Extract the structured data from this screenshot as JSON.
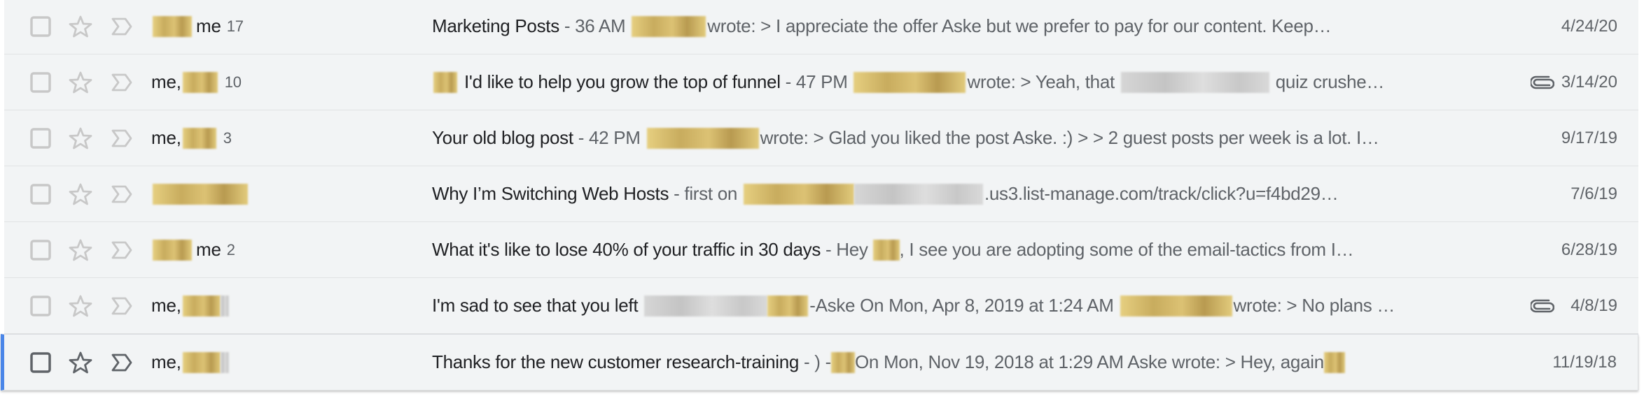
{
  "colors": {
    "row_bg": "#f2f4f5",
    "active_indicator": "#4a86e8",
    "primary_text": "#202124",
    "secondary_text": "#5f6368",
    "icon_inactive": "#c8c8c8",
    "icon_active": "#5f6368"
  },
  "icons": {
    "checkbox": "checkbox-icon",
    "star": "star-icon",
    "importance": "importance-marker-icon",
    "attachment": "paperclip-icon"
  },
  "threads": [
    {
      "sender_prefix": "",
      "sender_redacted": true,
      "sender_suffix": "me",
      "count": "17",
      "subject": "Marketing Posts",
      "snippet_parts": [
        " - 36 AM ",
        "[redacted]",
        "wrote: > I appreciate the offer Aske but we prefer to pay for our content. Keep…"
      ],
      "has_attachment": false,
      "date": "4/24/20"
    },
    {
      "sender_prefix": "me,",
      "sender_redacted": true,
      "sender_suffix": "",
      "count": "10",
      "subject_prefix_redacted": true,
      "subject": "I'd like to help you grow the top of funnel",
      "snippet_parts": [
        " - 47 PM ",
        "[redacted]",
        "wrote: > Yeah, that ",
        "[redacted]",
        " quiz crushe…"
      ],
      "has_attachment": true,
      "date": "3/14/20"
    },
    {
      "sender_prefix": "me,",
      "sender_redacted": true,
      "sender_suffix": "",
      "count": "3",
      "subject": "Your old blog post",
      "snippet_parts": [
        " - 42 PM ",
        "[redacted]",
        "wrote: > Glad you liked the post Aske. :) > > 2 guest posts per week is a lot. I…"
      ],
      "has_attachment": false,
      "date": "9/17/19"
    },
    {
      "sender_prefix": "",
      "sender_redacted": true,
      "sender_suffix": "",
      "count": "",
      "subject": "Why I’m Switching Web Hosts",
      "snippet_parts": [
        " - first on ",
        "[redacted]",
        "[redacted]",
        ".us3.list-manage.com/track/click?u=f4bd29…"
      ],
      "has_attachment": false,
      "date": "7/6/19"
    },
    {
      "sender_prefix": "",
      "sender_redacted": true,
      "sender_suffix": "me",
      "count": "2",
      "subject": "What it's like to lose 40% of your traffic in 30 days",
      "snippet_parts": [
        " - Hey ",
        "[redacted]",
        ", I see you are adopting some of the email-tactics from I…"
      ],
      "has_attachment": false,
      "date": "6/28/19"
    },
    {
      "sender_prefix": "me,",
      "sender_redacted": true,
      "sender_suffix": "",
      "count": "",
      "subject": "I'm sad to see that you left",
      "snippet_parts": [
        " ",
        "[redacted]",
        "[redacted]",
        "-Aske On Mon, Apr 8, 2019 at 1:24 AM ",
        "[redacted]",
        "wrote: > No plans …"
      ],
      "has_attachment": true,
      "date": "4/8/19"
    },
    {
      "sender_prefix": "me,",
      "sender_redacted": true,
      "sender_suffix": "",
      "count": "",
      "subject": "Thanks for the new customer research-training",
      "snippet_parts": [
        " - ) -",
        "[redacted]",
        "On Mon, Nov 19, 2018 at 1:29 AM Aske wrote: > Hey, again",
        "[redacted]"
      ],
      "has_attachment": false,
      "date": "11/19/18",
      "active": true
    }
  ]
}
